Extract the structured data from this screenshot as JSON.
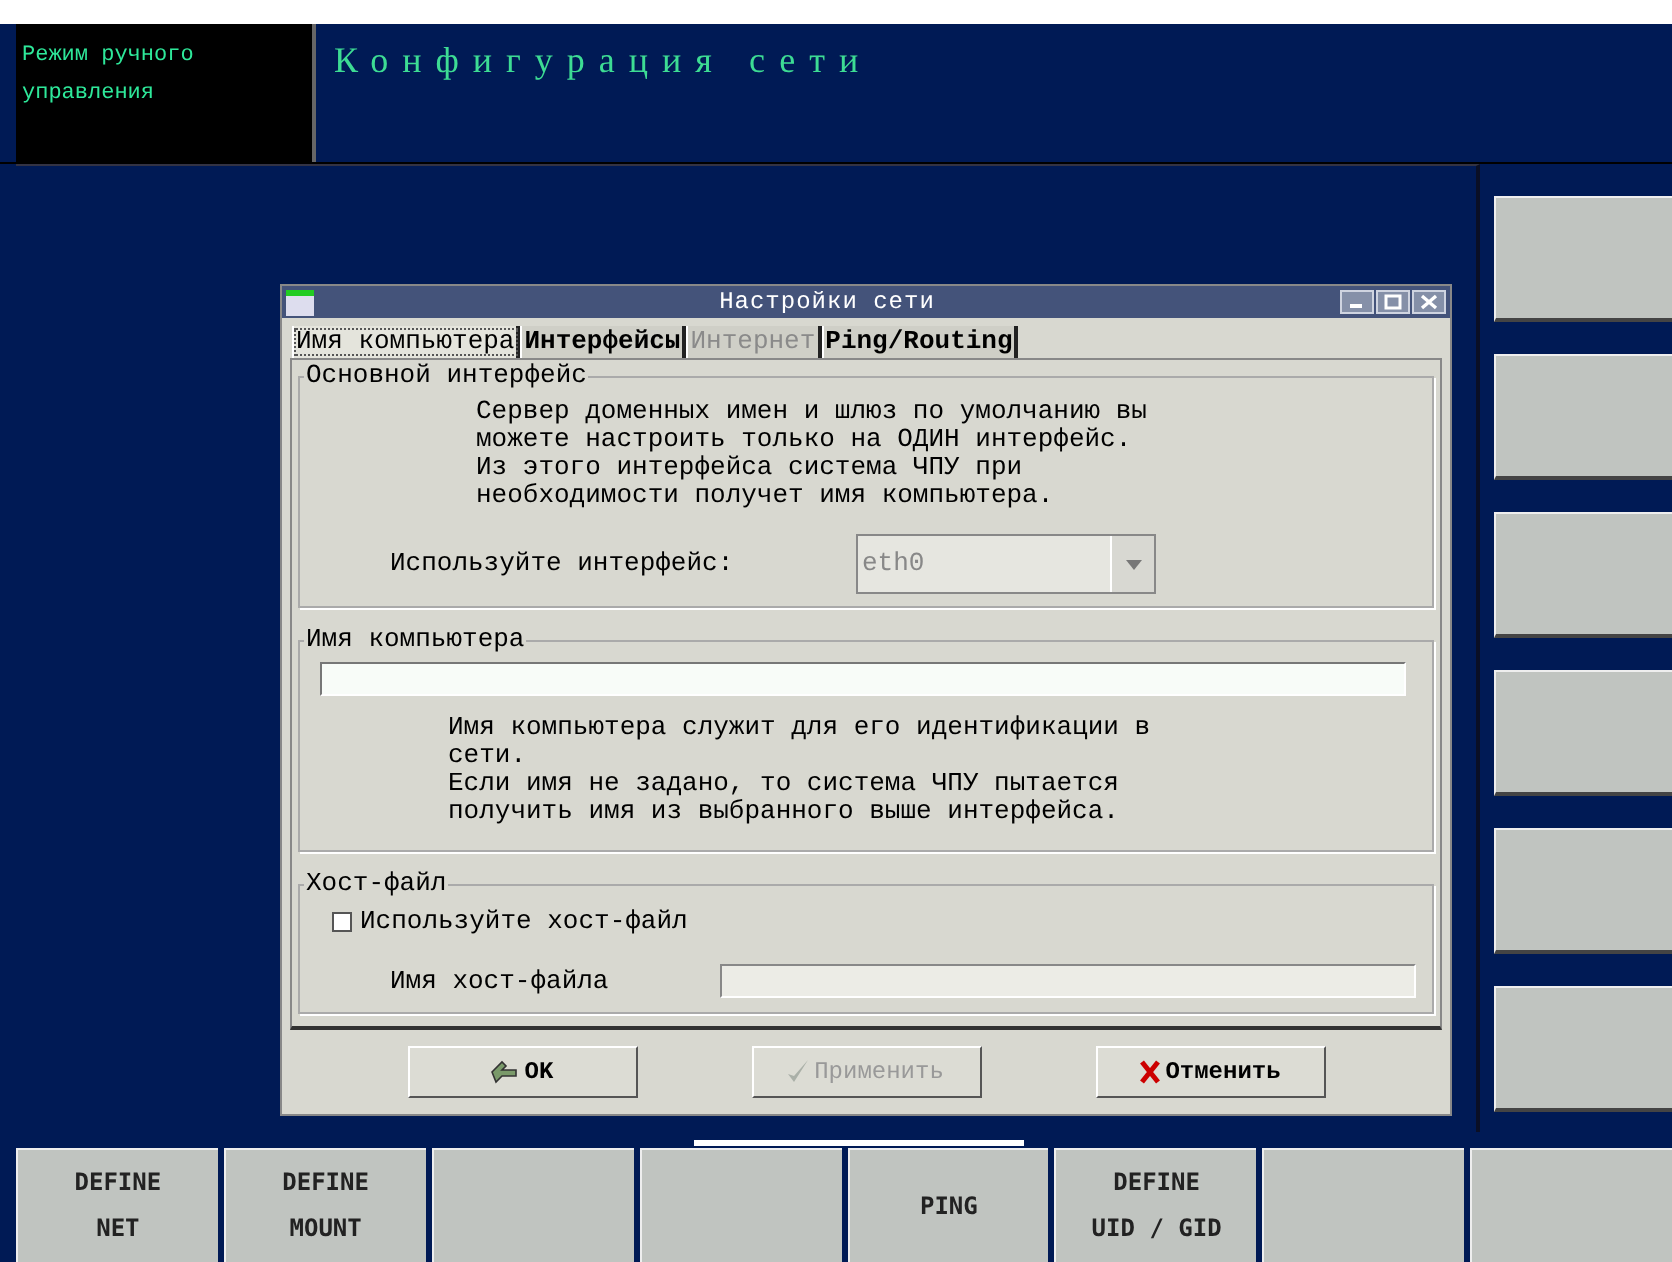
{
  "mode_panel": {
    "text": "Режим ручного управления"
  },
  "screen_title": "Конфигурация сети",
  "dialog": {
    "title": "Настройки сети",
    "tabs": [
      {
        "label": "Имя компьютера",
        "selected": true,
        "disabled": false
      },
      {
        "label": "Интерфейсы",
        "selected": false,
        "disabled": false
      },
      {
        "label": "Интернет",
        "selected": false,
        "disabled": true
      },
      {
        "label": "Ping/Routing",
        "selected": false,
        "disabled": false
      }
    ],
    "groups": [
      {
        "kind": "interface",
        "title": "Основной интерфейс",
        "description": [
          "Сервер доменных имен и шлюз по умолчанию вы",
          "можете настроить только на ОДИН интерфейс.",
          "Из этого интерфейса система ЧПУ при",
          "необходимости получет имя компьютера."
        ],
        "combo_label": "Используйте интерфейс:",
        "combo_value": "eth0",
        "combo_disabled": true
      },
      {
        "kind": "hostname",
        "title": "Имя компьютера",
        "description": [
          "Имя компьютера служит для его идентификации в",
          "сети.",
          "Если имя не задано, то система ЧПУ пытается",
          "получить имя из выбранного выше интерфейса."
        ]
      },
      {
        "kind": "hostfile",
        "title": "Хост-файл",
        "checkbox_label": "Используйте хост-файл",
        "checked": false,
        "field_label": "Имя хост-файла"
      }
    ],
    "buttons": [
      {
        "kind": "ok",
        "label": "OK",
        "disabled": false
      },
      {
        "kind": "apply",
        "label": "Применить",
        "disabled": true
      },
      {
        "kind": "cancel",
        "label": "Отменить",
        "disabled": false
      }
    ]
  },
  "bottom_softkeys": [
    {
      "kind": "labeled",
      "lines": [
        "DEFINE",
        "NET"
      ]
    },
    {
      "kind": "labeled",
      "lines": [
        "DEFINE",
        "MOUNT"
      ]
    },
    {
      "kind": "blank"
    },
    {
      "kind": "blank"
    },
    {
      "kind": "labeled",
      "lines": [
        "PING"
      ]
    },
    {
      "kind": "labeled",
      "lines": [
        "DEFINE",
        "UID / GID"
      ]
    },
    {
      "kind": "blank"
    },
    {
      "kind": "blank"
    }
  ]
}
